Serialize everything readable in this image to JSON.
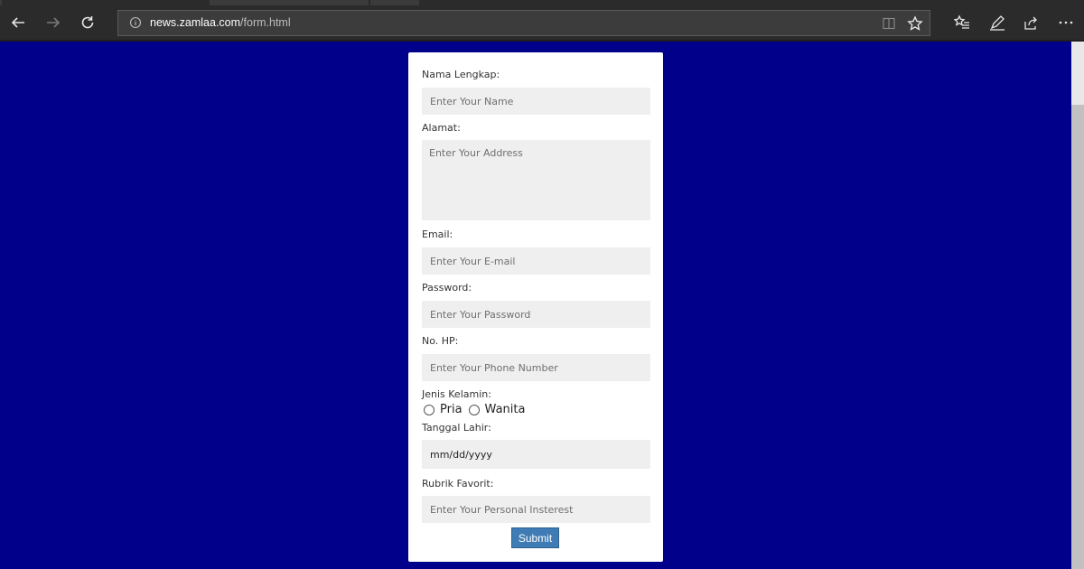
{
  "browser": {
    "url_host": "news.zamlaa.com",
    "url_path": "/form.html",
    "icons": {
      "back": "back-arrow-icon",
      "forward": "forward-arrow-icon",
      "refresh": "refresh-icon",
      "info": "info-icon",
      "reading_view": "reading-view-icon",
      "favorite": "star-icon",
      "favorites_hub": "favorites-list-icon",
      "web_note": "pen-icon",
      "share": "share-icon",
      "more": "more-dots-icon"
    }
  },
  "form": {
    "name_label": "Nama Lengkap:",
    "name_placeholder": "Enter Your Name",
    "address_label": "Alamat:",
    "address_placeholder": "Enter Your Address",
    "email_label": "Email:",
    "email_placeholder": "Enter Your E-mail",
    "password_label": "Password:",
    "password_placeholder": "Enter Your Password",
    "phone_label": "No. HP:",
    "phone_placeholder": "Enter Your Phone Number",
    "gender_label": "Jenis Kelamin:",
    "gender_options": [
      "Pria",
      "Wanita"
    ],
    "birthdate_label": "Tanggal Lahir:",
    "birthdate_value": "mm/dd/yyyy",
    "interest_label": "Rubrik Favorit:",
    "interest_placeholder": "Enter Your Personal Insterest",
    "submit_label": "Submit"
  },
  "colors": {
    "page_background": "#00008b",
    "card_background": "#ffffff",
    "input_background": "#efefef",
    "submit_background": "#3f7bb4",
    "browser_chrome": "#2b2b2b"
  }
}
